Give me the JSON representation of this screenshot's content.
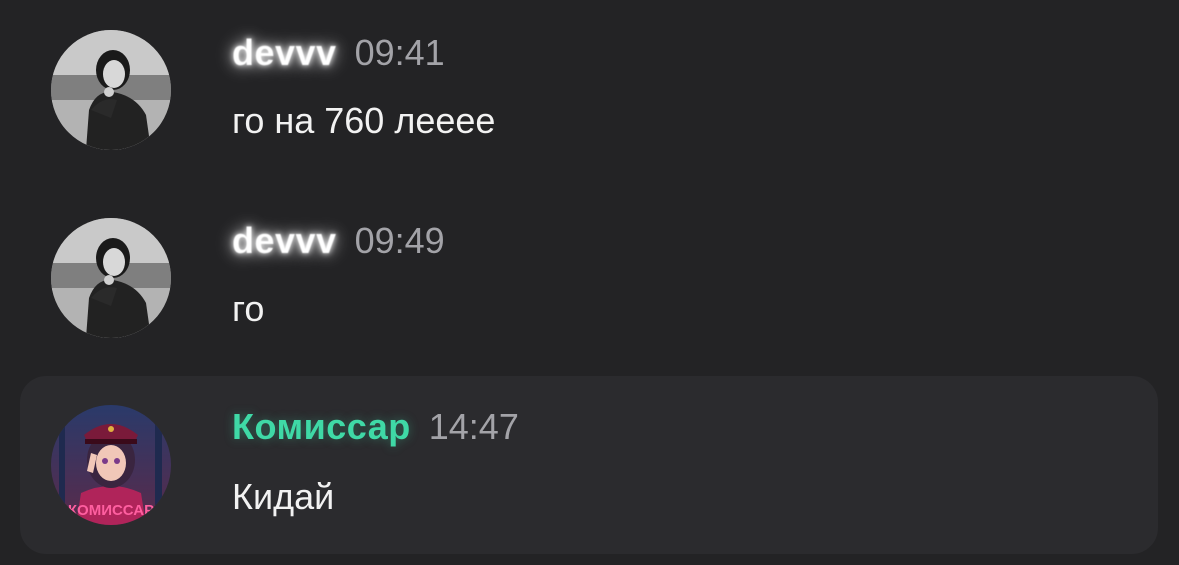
{
  "messages": [
    {
      "author": "devvv",
      "author_color": "#ffffff",
      "time": "09:41",
      "text": "го на 760 леееe",
      "avatar": "user-photo-avatar"
    },
    {
      "author": "devvv",
      "author_color": "#ffffff",
      "time": "09:49",
      "text": "го",
      "avatar": "user-photo-avatar"
    },
    {
      "author": "Комиссар",
      "author_color": "#3fd9a6",
      "time": "14:47",
      "text": "Кидай",
      "avatar": "bot-anime-avatar",
      "avatar_caption": "КОМИССАР",
      "highlighted": true
    }
  ],
  "colors": {
    "background": "#232325",
    "highlight_background": "#2b2b2e",
    "accent": "#3fd9a6",
    "timestamp": "#a3a3a8"
  }
}
